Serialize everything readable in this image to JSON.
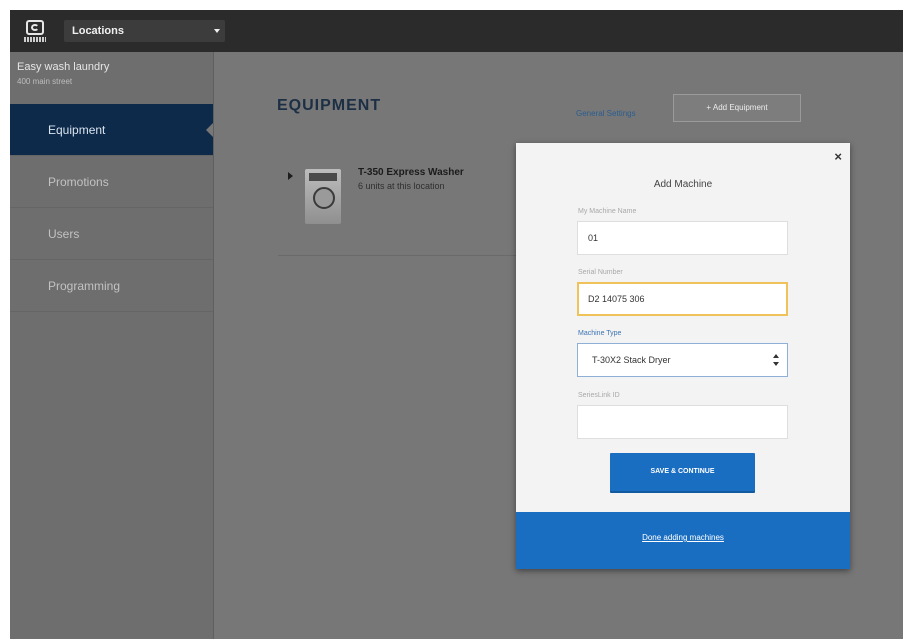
{
  "topbar": {
    "location_select": "Locations"
  },
  "sidebar": {
    "org_name": "Easy wash laundry",
    "org_sub": "400 main street",
    "items": [
      {
        "label": "Equipment",
        "active": true
      },
      {
        "label": "Promotions",
        "active": false
      },
      {
        "label": "Users",
        "active": false
      },
      {
        "label": "Programming",
        "active": false
      }
    ]
  },
  "main": {
    "title": "EQUIPMENT",
    "general_settings": "General Settings",
    "add_equipment": "+ Add Equipment",
    "equipment": [
      {
        "name": "T-350 Express Washer",
        "units": "6 units at this location"
      }
    ]
  },
  "modal": {
    "close": "×",
    "title": "Add Machine",
    "fields": {
      "machine_name": {
        "label": "My Machine Name",
        "value": "01"
      },
      "serial_number": {
        "label": "Serial Number",
        "value": "D2 14075 306"
      },
      "machine_type": {
        "label": "Machine Type",
        "value": "T-30X2 Stack Dryer"
      },
      "seller_id": {
        "label": "SeriesLink ID",
        "value": ""
      }
    },
    "save_label": "SAVE & CONTINUE",
    "done_label": "Done adding machines"
  },
  "colors": {
    "accent_blue": "#1a6ec2",
    "nav_active": "#0d2a4a",
    "topbar": "#2b2b2b",
    "warning_border": "#f0c35a"
  },
  "icons": {
    "logo": "brand-logo",
    "close": "close-icon",
    "dropdown": "chevron-down-icon",
    "expand": "caret-right-icon",
    "select_arrows": "select-arrows-icon"
  }
}
